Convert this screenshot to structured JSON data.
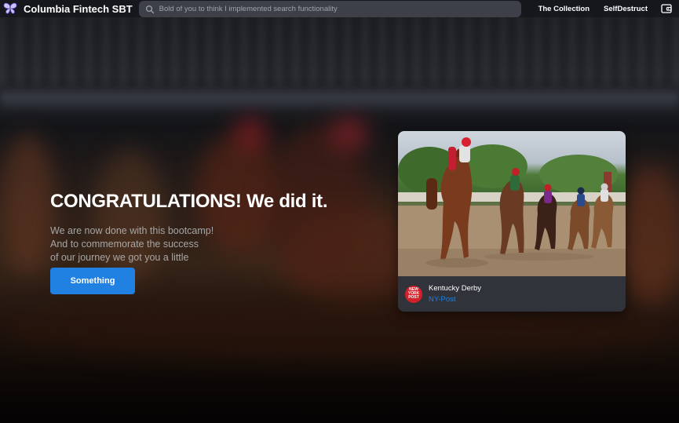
{
  "navbar": {
    "brand": "Columbia Fintech SBT",
    "search_placeholder": "Bold of you to think I implemented search functionality",
    "links": [
      "The Collection",
      "SelfDestruct"
    ],
    "logo_icon": "butterfly-icon",
    "wallet_icon": "wallet-icon",
    "search_icon": "search-icon"
  },
  "hero": {
    "headline": "CONGRATULATIONS! We did it.",
    "lines": [
      "We are now done with this bootcamp!",
      "And to commemorate the success",
      "of our journey we got you a little"
    ],
    "button_label": "Something"
  },
  "card": {
    "title": "Kentucky Derby",
    "source": "NY-Post",
    "publisher_logo": "NEW YORK POST"
  },
  "colors": {
    "accent": "#2081e2",
    "navbar": "#14161c",
    "card": "#303339"
  }
}
